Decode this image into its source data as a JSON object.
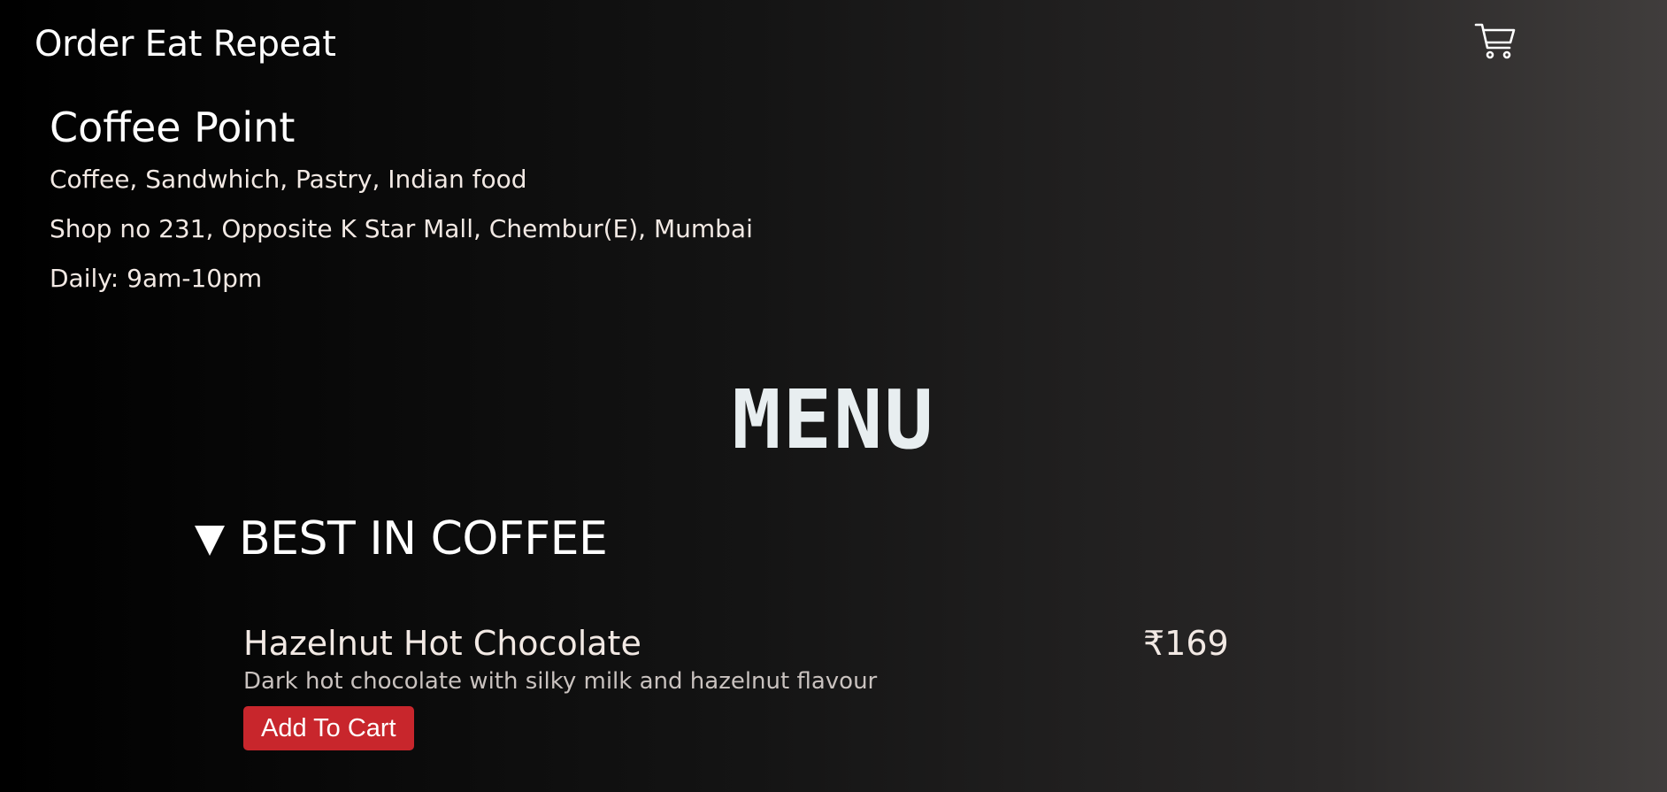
{
  "header": {
    "brand": "Order Eat Repeat",
    "cart_icon": "cart-icon"
  },
  "shop": {
    "name": "Coffee Point",
    "cuisines": "Coffee, Sandwhich, Pastry, Indian food",
    "address": "Shop no 231, Opposite K Star Mall, Chembur(E), Mumbai",
    "hours": "Daily: 9am-10pm"
  },
  "menu": {
    "heading": "MENU",
    "sections": [
      {
        "title": "BEST IN COFFEE",
        "expanded": true,
        "items": [
          {
            "name": "Hazelnut Hot Chocolate",
            "price": "₹169",
            "description": "Dark hot chocolate with silky milk and hazelnut flavour",
            "button_label": "Add To Cart"
          }
        ]
      }
    ]
  },
  "colors": {
    "button": "#c8262c",
    "text": "#f2e9e4",
    "heading": "#e8eef0"
  }
}
